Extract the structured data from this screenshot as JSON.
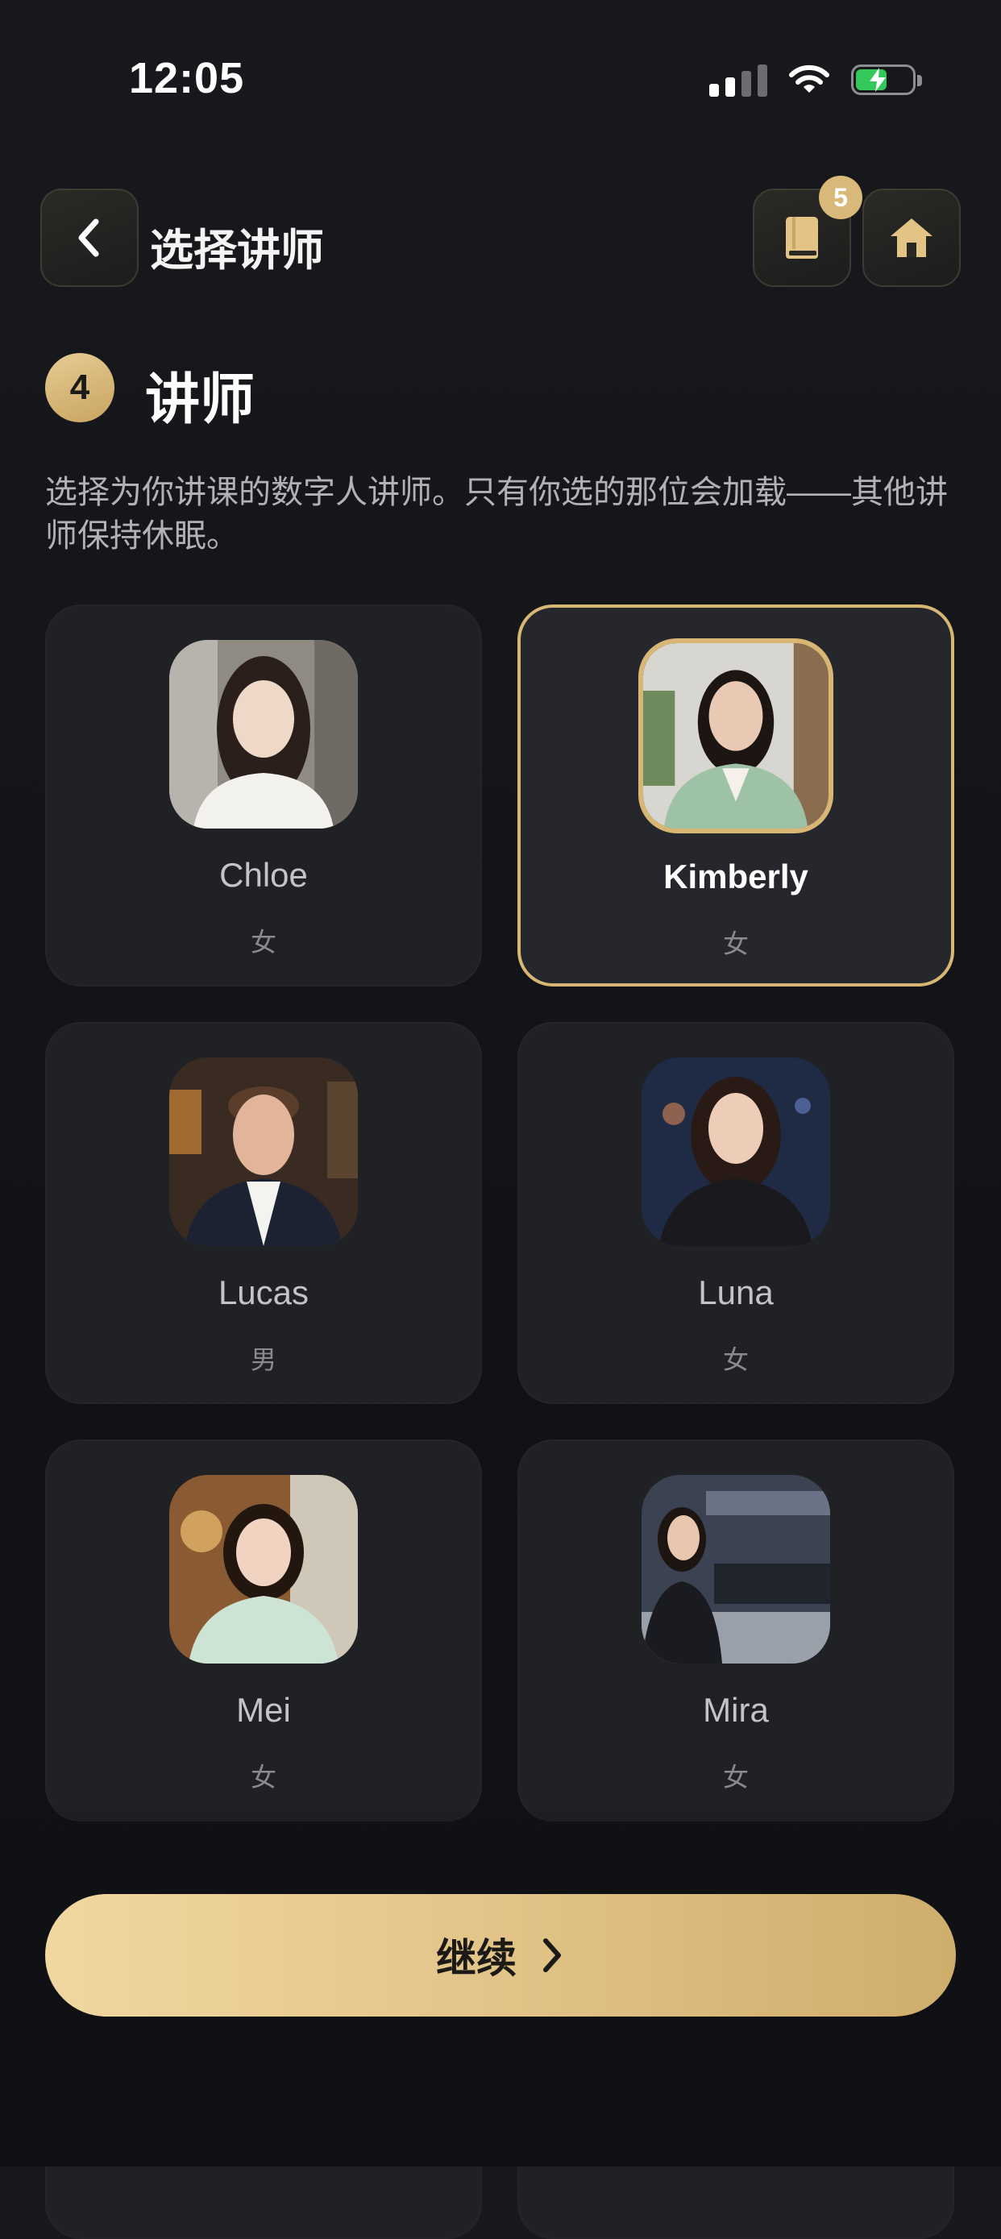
{
  "status_bar": {
    "time": "12:05"
  },
  "header": {
    "title": "选择讲师",
    "badge_count": "5"
  },
  "section": {
    "step": "4",
    "title": "讲师",
    "description": "选择为你讲课的数字人讲师。只有你选的那位会加载——其他讲师保持休眠。"
  },
  "lecturers": [
    {
      "name": "Chloe",
      "gender": "女",
      "selected": false
    },
    {
      "name": "Kimberly",
      "gender": "女",
      "selected": true
    },
    {
      "name": "Lucas",
      "gender": "男",
      "selected": false
    },
    {
      "name": "Luna",
      "gender": "女",
      "selected": false
    },
    {
      "name": "Mei",
      "gender": "女",
      "selected": false
    },
    {
      "name": "Mira",
      "gender": "女",
      "selected": false
    }
  ],
  "footer": {
    "continue_label": "继续"
  },
  "colors": {
    "accent": "#d8b673",
    "background": "#131418",
    "card": "#202125"
  },
  "icons": {
    "back": "chevron-left-icon",
    "book": "book-icon",
    "home": "home-icon",
    "continue": "chevron-right-icon"
  }
}
